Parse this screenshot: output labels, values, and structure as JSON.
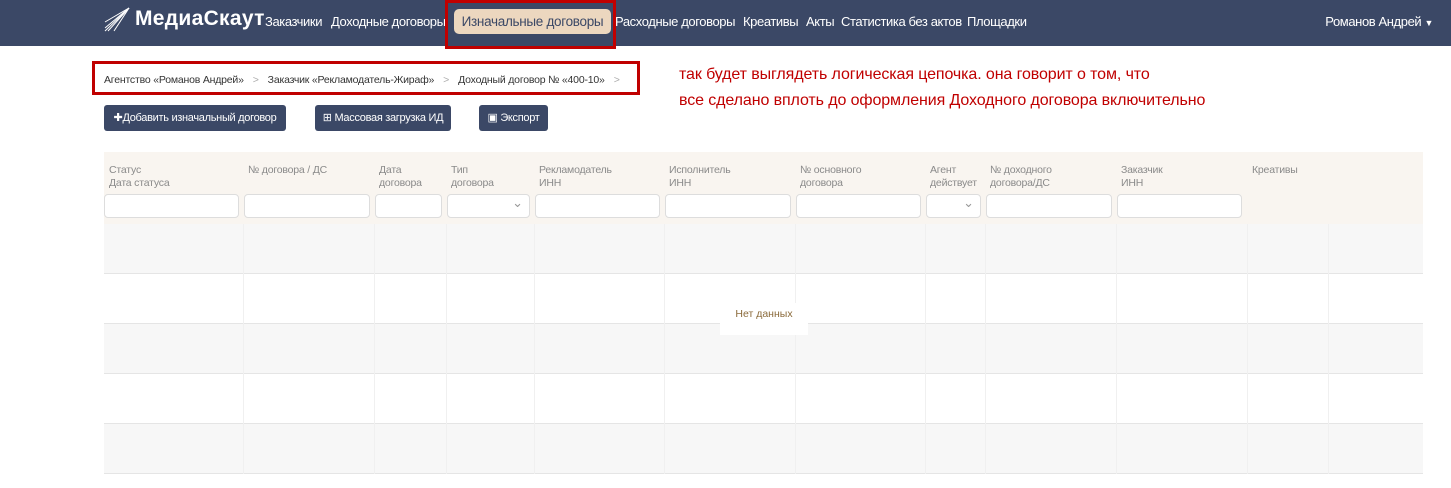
{
  "nav": {
    "logo": "МедиаСкаут",
    "items": [
      "Заказчики",
      "Доходные договоры",
      "Изначальные договоры",
      "Расходные договоры",
      "Креативы",
      "Акты",
      "Статистика без актов",
      "Площадки"
    ],
    "active": "Изначальные договоры",
    "user": "Романов Андрей"
  },
  "breadcrumb": [
    "Агентство «Романов Андрей»",
    "Заказчик «Рекламодатель-Жираф»",
    "Доходный договор № «400-10»"
  ],
  "annotation": [
    "так будет выглядеть логическая цепочка. она говорит о том, что",
    "все сделано вплоть до оформления Доходного договора включительно"
  ],
  "buttons": {
    "add": "Добавить изначальный договор",
    "bulk": "Массовая загрузка ИД",
    "export": "Экспорт"
  },
  "table": {
    "columns": [
      [
        "Статус",
        "Дата статуса"
      ],
      [
        "№ договора / ДС",
        ""
      ],
      [
        "Дата",
        "договора"
      ],
      [
        "Тип",
        "договора"
      ],
      [
        "Рекламодатель",
        "ИНН"
      ],
      [
        "Исполнитель",
        "ИНН"
      ],
      [
        "№ основного",
        "договора"
      ],
      [
        "Агент",
        "действует"
      ],
      [
        "№ доходного",
        "договора/ДС"
      ],
      [
        "Заказчик",
        "ИНН"
      ],
      [
        "Креативы",
        ""
      ]
    ],
    "empty": "Нет данных"
  },
  "colors": {
    "nav": "#3b4866",
    "active": "#ecd7bf",
    "annotation": "#c00000"
  }
}
